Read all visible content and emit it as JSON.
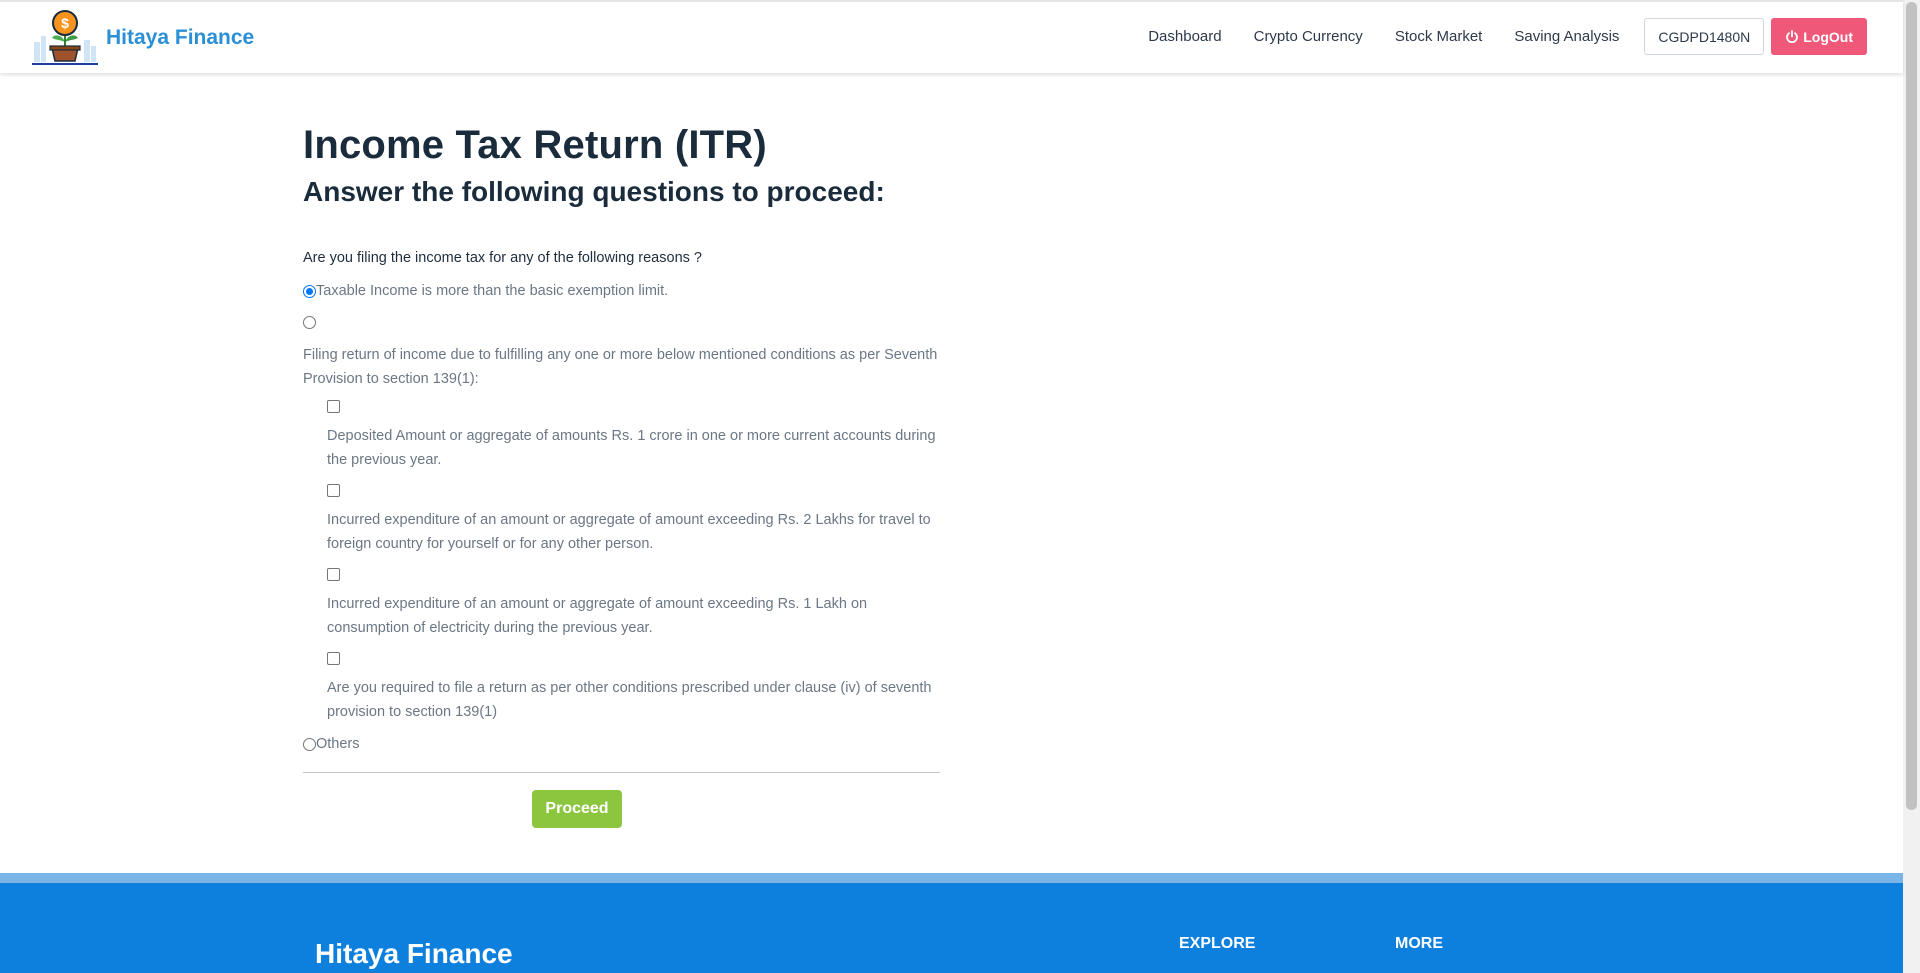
{
  "header": {
    "brand": "Hitaya Finance",
    "nav": [
      "Dashboard",
      "Crypto Currency",
      "Stock Market",
      "Saving Analysis"
    ],
    "user_id": "CGDPD1480N",
    "logout_label": "LogOut"
  },
  "main": {
    "title": "Income Tax Return (ITR)",
    "subtitle": "Answer the following questions to proceed:",
    "question": "Are you filing the income tax for any of the following reasons ?",
    "option1": "Taxable Income is more than the basic exemption limit.",
    "option2": "Filing return of income due to fulfilling any one or more below mentioned conditions as per Seventh Provision to section 139(1):",
    "conditions": [
      "Deposited Amount or aggregate of amounts Rs. 1 crore in one or more current accounts during the previous year.",
      "Incurred expenditure of an amount or aggregate of amount exceeding Rs. 2 Lakhs for travel to foreign country for yourself or for any other person.",
      "Incurred expenditure of an amount or aggregate of amount exceeding Rs. 1 Lakh on consumption of electricity during the previous year.",
      "Are you required to file a return as per other conditions prescribed under clause (iv) of seventh provision to section 139(1)"
    ],
    "option3": "Others",
    "selected_option": 1,
    "proceed_label": "Proceed"
  },
  "footer": {
    "brand": "Hitaya Finance",
    "col1": "EXPLORE",
    "col2": "MORE"
  },
  "colors": {
    "brand": "#2b8fd6",
    "logout": "#f0587a",
    "proceed": "#8cc63f",
    "footer": "#0d7fdc"
  }
}
